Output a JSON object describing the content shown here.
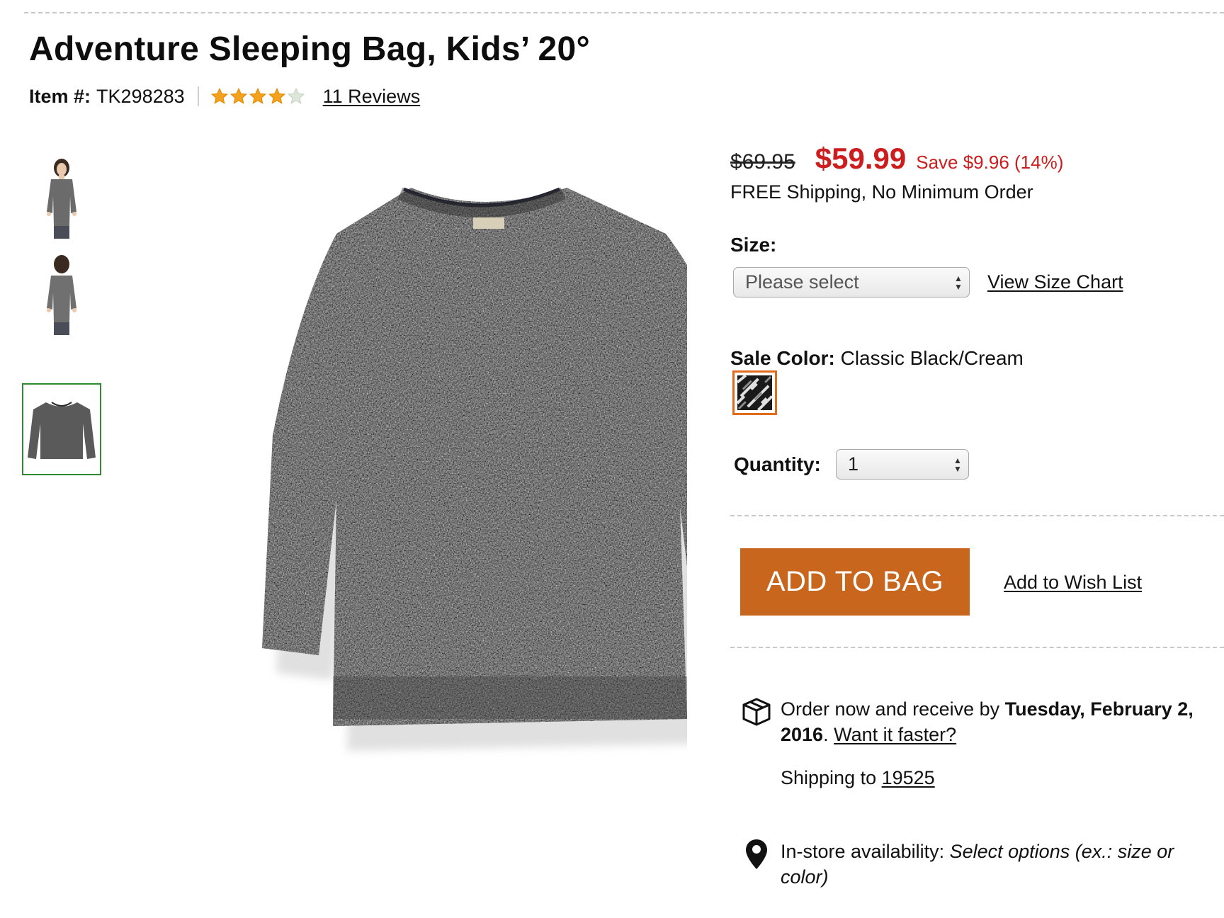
{
  "product": {
    "title": "Adventure Sleeping Bag, Kids’ 20°",
    "item_label": "Item #:",
    "item_number": "TK298283",
    "rating": 4,
    "rating_max": 5,
    "reviews_link": "11 Reviews"
  },
  "gallery": {
    "thumbnails": [
      {
        "name": "front-view",
        "selected": false
      },
      {
        "name": "back-view",
        "selected": false
      },
      {
        "name": "flat-sweater",
        "selected": true
      }
    ],
    "main_image": "knit-sweater",
    "selected_border_color": "#2e8b2e"
  },
  "pricing": {
    "original_price": "$69.95",
    "sale_price": "$59.99",
    "savings": "Save $9.96 (14%)",
    "shipping": "FREE Shipping, No Minimum Order",
    "sale_color": "#cc1e1e"
  },
  "size": {
    "label": "Size:",
    "value": "Please select",
    "chart_link": "View Size Chart"
  },
  "color": {
    "label": "Sale Color:",
    "value": "Classic Black/Cream",
    "swatch_border": "#e06b1c"
  },
  "quantity": {
    "label": "Quantity:",
    "value": "1"
  },
  "actions": {
    "add_to_bag": "ADD TO BAG",
    "add_to_bag_color": "#c9661e",
    "wish_list": "Add to Wish List"
  },
  "delivery": {
    "prefix": "Order now and receive by ",
    "date_bold": "Tuesday, February 2, 2016",
    "suffix": ". ",
    "faster_link": "Want it faster?",
    "shipping_to_label": "Shipping to ",
    "zip": "19525",
    "box_icon": "package-box-icon"
  },
  "instore": {
    "label": "In-store availability: ",
    "message": "Select options (ex.: size or color)",
    "pin_icon": "location-pin-icon"
  }
}
